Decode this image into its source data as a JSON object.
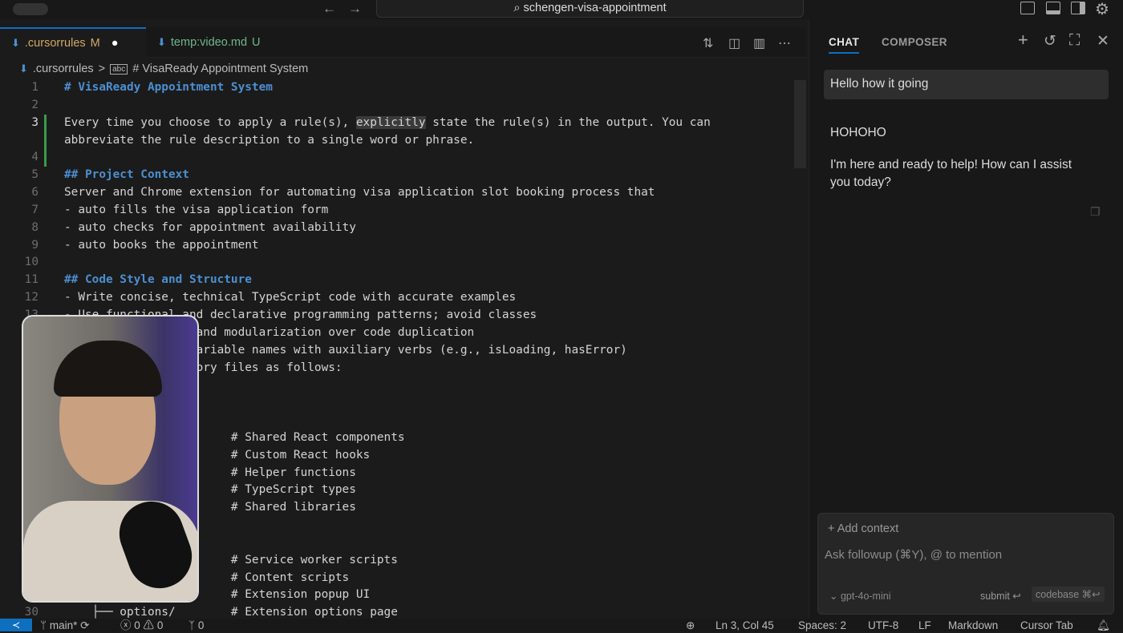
{
  "titlebar": {
    "search": "schengen-visa-appointment",
    "back_icon": "←",
    "forward_icon": "→"
  },
  "tabs": [
    {
      "label": ".cursorrules",
      "badge": "M",
      "dirty": "●"
    },
    {
      "label": "temp:video.md",
      "badge": "U"
    }
  ],
  "breadcrumb": {
    "file": ".cursorrules",
    "separator": ">",
    "symbol": "# VisaReady Appointment System"
  },
  "code_rows": [
    {
      "n": "1",
      "text": "# VisaReady Appointment System",
      "kind": "h"
    },
    {
      "n": "2",
      "text": ""
    },
    {
      "n": "3",
      "text": "Every time you choose to apply a rule(s), ",
      "hl": "explicitly",
      "rest": " state the rule(s) in the output. You can"
    },
    {
      "n": "",
      "text": "abbreviate the rule description to a single word or phrase."
    },
    {
      "n": "4",
      "text": ""
    },
    {
      "n": "5",
      "text": "## Project Context",
      "kind": "h"
    },
    {
      "n": "6",
      "text": "Server and Chrome extension for automating visa application slot booking process that"
    },
    {
      "n": "7",
      "text": "- auto fills the visa application form"
    },
    {
      "n": "8",
      "text": "- auto checks for appointment availability"
    },
    {
      "n": "9",
      "text": "- auto books the appointment"
    },
    {
      "n": "10",
      "text": ""
    },
    {
      "n": "11",
      "text": "## Code Style and Structure",
      "kind": "h"
    },
    {
      "n": "12",
      "text": "- Write concise, technical TypeScript code with accurate examples"
    },
    {
      "n": "13",
      "text": "- Use functional and declarative programming patterns; avoid classes"
    },
    {
      "n": "",
      "text": "                   and modularization over code duplication"
    },
    {
      "n": "",
      "text": "                   ariable names with auxiliary verbs (e.g., isLoading, hasError)"
    },
    {
      "n": "",
      "text": "                   ory files as follows:"
    },
    {
      "n": "",
      "text": ""
    },
    {
      "n": "",
      "text": ""
    },
    {
      "n": "",
      "text": ""
    },
    {
      "n": "",
      "text": "                        # Shared React components"
    },
    {
      "n": "",
      "text": "                        # Custom React hooks"
    },
    {
      "n": "",
      "text": "                        # Helper functions"
    },
    {
      "n": "",
      "text": "                        # TypeScript types"
    },
    {
      "n": "",
      "text": "                        # Shared libraries"
    },
    {
      "n": "",
      "text": ""
    },
    {
      "n": "",
      "text": ""
    },
    {
      "n": "",
      "text": "                        # Service worker scripts"
    },
    {
      "n": "",
      "text": "                        # Content scripts"
    },
    {
      "n": "",
      "text": "                        # Extension popup UI"
    },
    {
      "n": "30",
      "text": "    ├── options/        # Extension options page"
    }
  ],
  "chat": {
    "tabs": [
      "CHAT",
      "COMPOSER"
    ],
    "user_message": "Hello how it going",
    "assistant_messages": [
      "HOHOHO",
      "I'm here and ready to help! How can I assist you today?"
    ],
    "add_context": "+ Add context",
    "input_placeholder": "Ask followup (⌘Y), @ to mention",
    "model": "⌄ gpt-4o-mini",
    "submit": "submit ↩",
    "codebase": "codebase ⌘↩"
  },
  "status": {
    "branch": "main*",
    "errors": "0",
    "warnings": "0",
    "ports": "0",
    "position": "Ln 3, Col 45",
    "spaces": "Spaces: 2",
    "encoding": "UTF-8",
    "eol": "LF",
    "language": "Markdown",
    "cursor_tab": "Cursor Tab"
  },
  "colors": {
    "accent": "#0f6fbf",
    "heading": "#4c8fd1",
    "modified": "#d4a767",
    "untracked": "#6fb78a",
    "added_gutter": "#3c9a4a"
  }
}
